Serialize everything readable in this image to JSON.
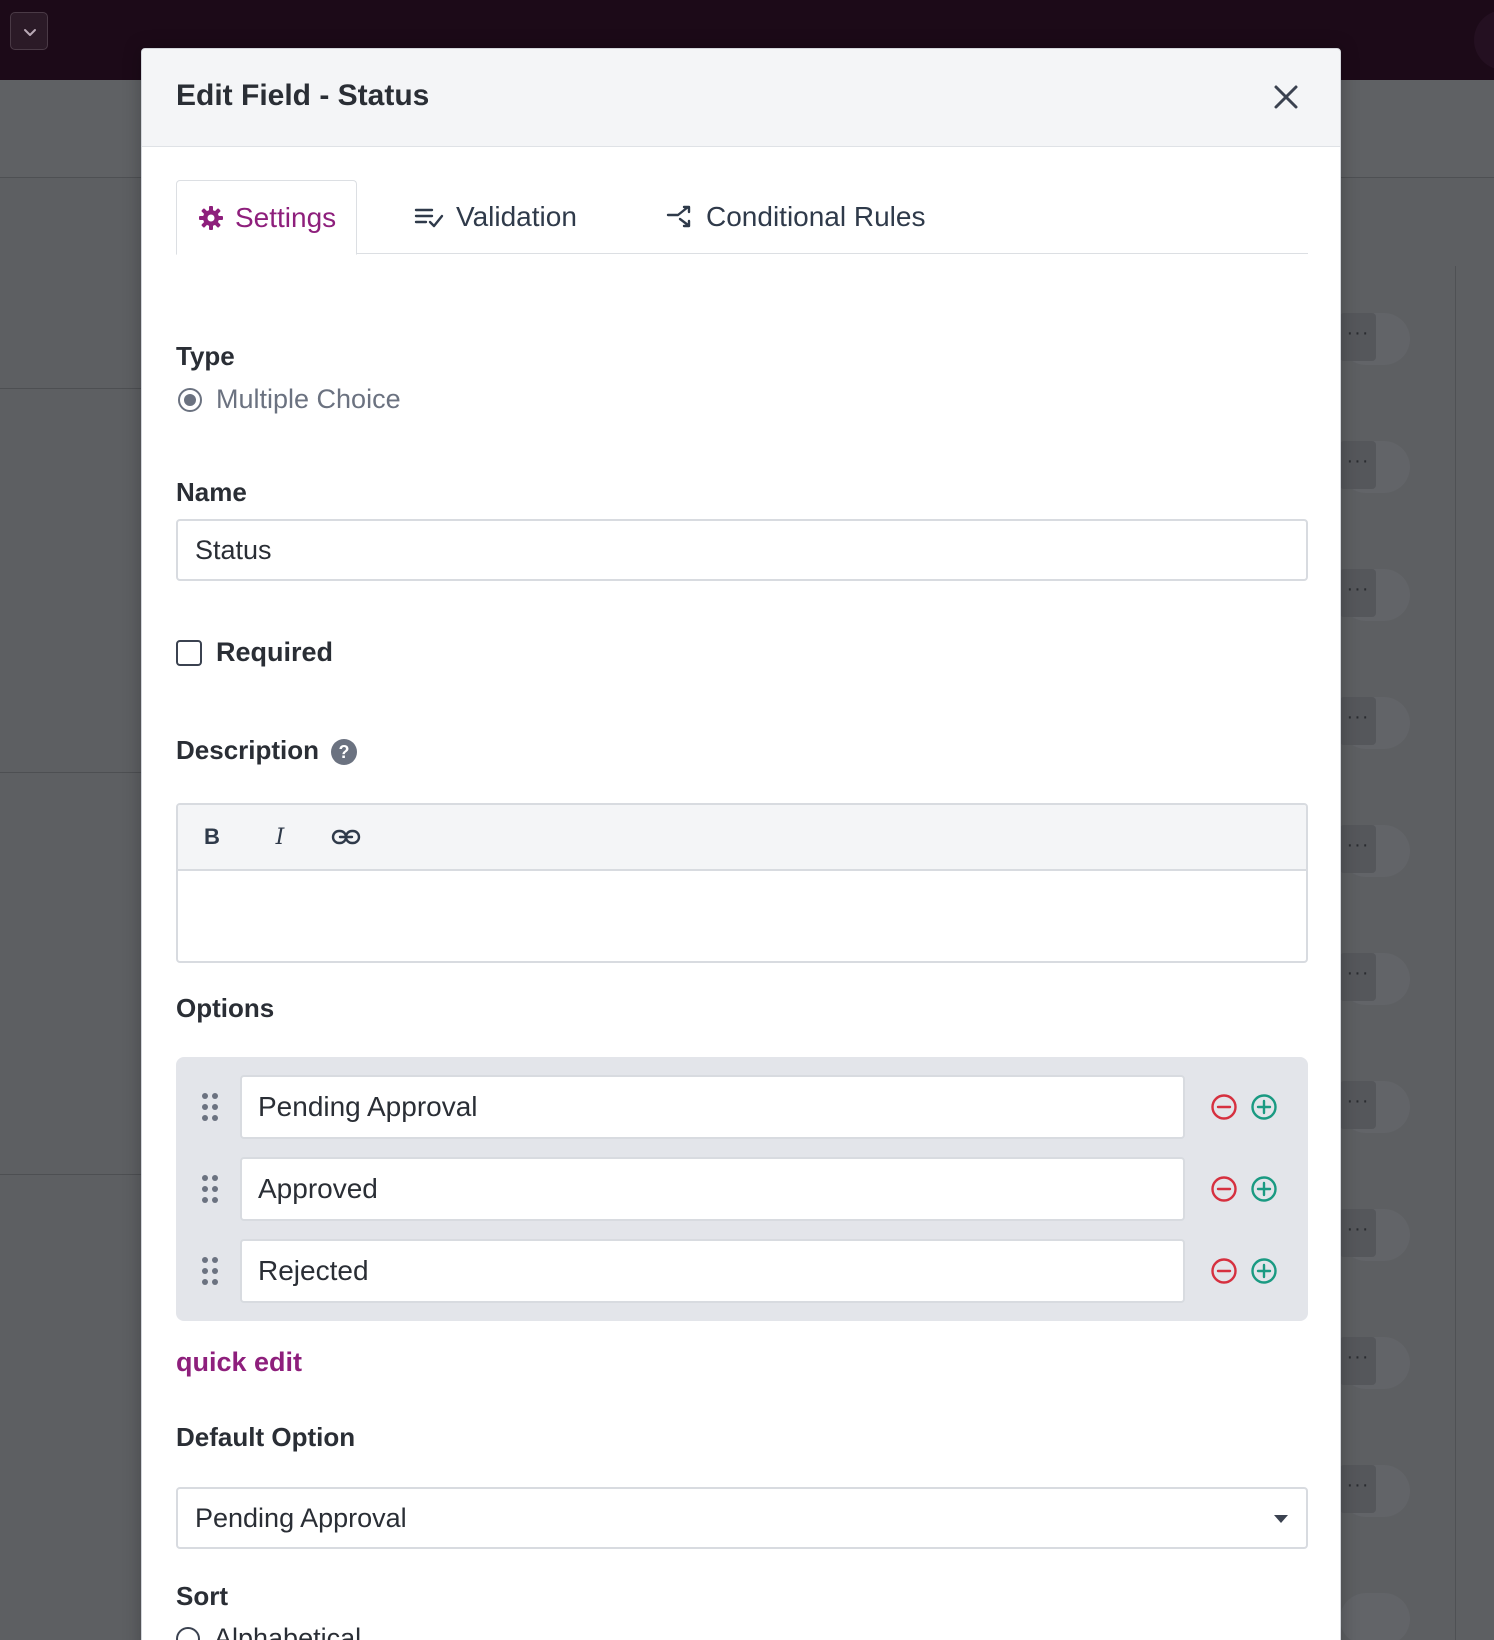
{
  "modal": {
    "title": "Edit Field - Status"
  },
  "tabs": [
    {
      "label": "Settings",
      "icon": "gear-icon",
      "active": true
    },
    {
      "label": "Validation",
      "icon": "list-check-icon",
      "active": false
    },
    {
      "label": "Conditional Rules",
      "icon": "branch-arrow-icon",
      "active": false
    }
  ],
  "type_section": {
    "label": "Type",
    "value": "Multiple Choice"
  },
  "name_section": {
    "label": "Name",
    "value": "Status"
  },
  "required": {
    "label": "Required",
    "checked": false
  },
  "description": {
    "label": "Description",
    "help_glyph": "?",
    "toolbar": {
      "bold": "B",
      "italic": "I"
    }
  },
  "options": {
    "label": "Options",
    "items": [
      "Pending Approval",
      "Approved",
      "Rejected"
    ],
    "quick_edit": "quick edit"
  },
  "default_option": {
    "label": "Default Option",
    "value": "Pending Approval"
  },
  "sort": {
    "label": "Sort",
    "first_option": "Alphabetical"
  },
  "colors": {
    "accent": "#8e1f7c",
    "remove": "#d6303f",
    "add": "#1a9a82"
  }
}
